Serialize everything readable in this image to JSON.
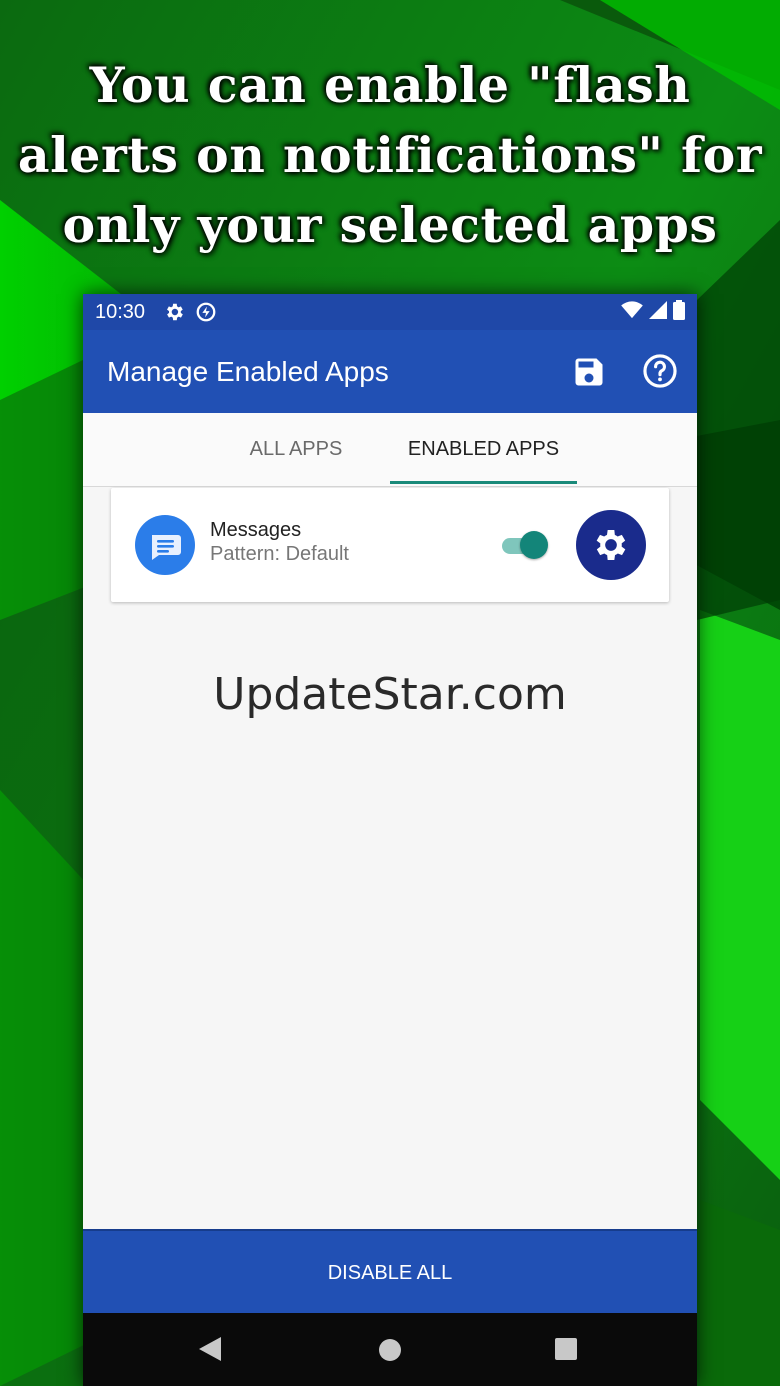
{
  "headline": {
    "line1": "You can enable \"flash",
    "line2": "alerts on notifications\" for",
    "line3": "only your selected apps"
  },
  "status_bar": {
    "time": "10:30",
    "left_icons": [
      "settings-icon",
      "data-saver-icon"
    ],
    "right_icons": [
      "wifi-icon",
      "cell-signal-icon",
      "battery-icon"
    ]
  },
  "app_bar": {
    "title": "Manage Enabled Apps",
    "actions": [
      "save-icon",
      "help-icon"
    ]
  },
  "tabs": [
    {
      "label": "ALL APPS",
      "selected": false
    },
    {
      "label": "ENABLED APPS",
      "selected": true
    }
  ],
  "apps": [
    {
      "name": "Messages",
      "pattern": "Pattern: Default",
      "enabled": true,
      "icon": "messages-icon"
    }
  ],
  "watermark": "UpdateStar.com",
  "bottom_button": {
    "label": "DISABLE ALL"
  },
  "nav": [
    "back-icon",
    "home-icon",
    "recents-icon"
  ],
  "colors": {
    "primary": "#2150b4",
    "accent": "#138579",
    "settings_button": "#1a2b8c",
    "background_green": "#0a7a10"
  }
}
